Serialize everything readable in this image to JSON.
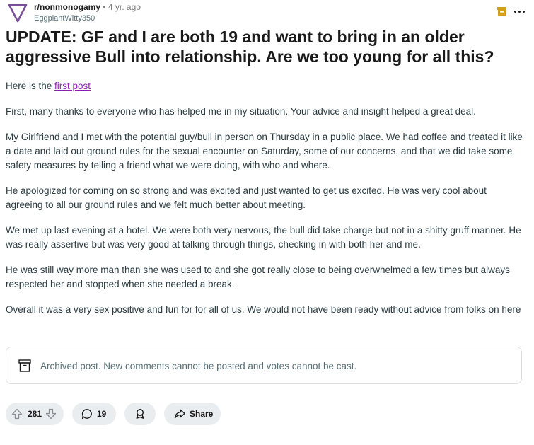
{
  "post": {
    "subreddit": "r/nonmonogamy",
    "separator": "•",
    "age": "4 yr. ago",
    "author": "EggplantWitty350",
    "title": "UPDATE: GF and I are both 19 and want to bring in an older aggressive Bull into relationship. Are we too young for all this?",
    "intro_text": "Here is the ",
    "intro_link": "first post",
    "paragraphs": [
      "First, many thanks to everyone who has helped me in my situation. Your advice and insight helped a great deal.",
      "My Girlfriend and I met with the potential guy/bull in person on Thursday in a public place. We had coffee and treated it like a date and laid out ground rules for the sexual encounter on Saturday, some of our concerns, and that we did take some safety measures by telling a friend what we were doing, with who and where.",
      "He apologized for coming on so strong and was excited and just wanted to get us excited. He was very cool about agreeing to all our ground rules and we felt much better about meeting.",
      "We met up last evening at a hotel. We were both very nervous, the bull did take charge but not in a shitty gruff manner. He was really assertive but was very good at talking through things, checking in with both her and me.",
      "He was still way more man than she was used to and she got really close to being overwhelmed a few times but always respected her and stopped when she needed a break.",
      "Overall it was a very sex positive and fun for for all of us. We would not have been ready without advice from folks on here"
    ],
    "archived_notice": "Archived post. New comments cannot be posted and votes cannot be cast."
  },
  "actions": {
    "votes": "281",
    "comments": "19",
    "share_label": "Share"
  },
  "colors": {
    "link": "#8a1fb5",
    "archive_icon": "#d4a017",
    "avatar": "#7a4f9a",
    "pill_bg": "#eaedef"
  }
}
